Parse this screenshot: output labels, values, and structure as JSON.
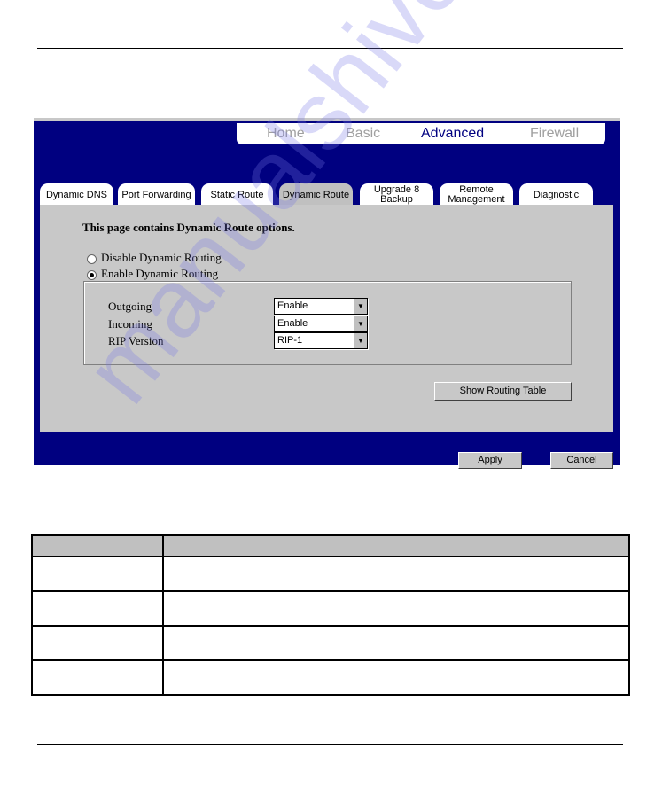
{
  "nav": {
    "items": [
      {
        "label": "Home",
        "active": false
      },
      {
        "label": "Basic",
        "active": false
      },
      {
        "label": "Advanced",
        "active": true
      },
      {
        "label": "Firewall",
        "active": false
      }
    ]
  },
  "tabs": [
    {
      "label": "Dynamic DNS"
    },
    {
      "label": "Port Forwarding"
    },
    {
      "label": "Static Route"
    },
    {
      "label": "Dynamic Route",
      "active": true
    },
    {
      "label": "Upgrade 8\nBackup"
    },
    {
      "label": "Remote\nManagement"
    },
    {
      "label": "Diagnostic"
    }
  ],
  "content": {
    "heading": "This page contains Dynamic Route options.",
    "radio_disable": {
      "label": "Disable Dynamic Routing",
      "checked": false
    },
    "radio_enable": {
      "label": "Enable Dynamic Routing",
      "checked": true
    },
    "fields": [
      {
        "label": "Outgoing",
        "value": "Enable"
      },
      {
        "label": "Incoming",
        "value": "Enable"
      },
      {
        "label": "RIP Version",
        "value": "RIP-1"
      }
    ],
    "show_table": "Show Routing Table"
  },
  "buttons": {
    "apply": "Apply",
    "cancel": "Cancel"
  },
  "colors": {
    "frame": "#000080",
    "panel": "#c8c8c8",
    "table_header": "#c0c0c0"
  },
  "watermark": "manualshive.com"
}
